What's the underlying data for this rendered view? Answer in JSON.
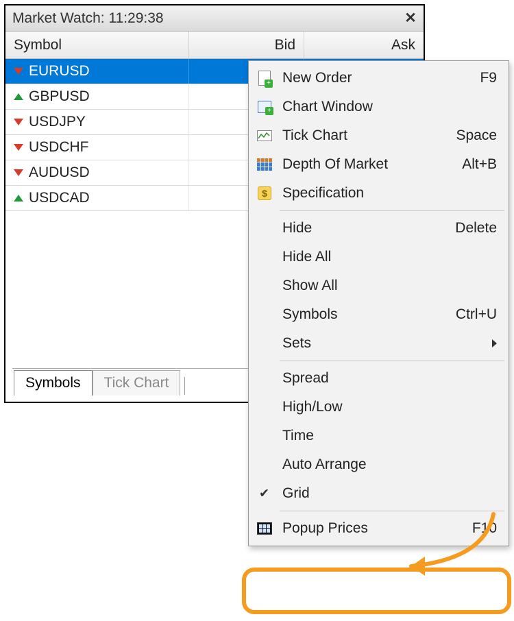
{
  "window": {
    "title": "Market Watch: 11:29:38"
  },
  "columns": {
    "symbol": "Symbol",
    "bid": "Bid",
    "ask": "Ask"
  },
  "rows": [
    {
      "symbol": "EURUSD",
      "direction": "down",
      "selected": true
    },
    {
      "symbol": "GBPUSD",
      "direction": "up",
      "selected": false
    },
    {
      "symbol": "USDJPY",
      "direction": "down",
      "selected": false
    },
    {
      "symbol": "USDCHF",
      "direction": "down",
      "selected": false
    },
    {
      "symbol": "AUDUSD",
      "direction": "down",
      "selected": false
    },
    {
      "symbol": "USDCAD",
      "direction": "up",
      "selected": false
    }
  ],
  "tabs": {
    "symbols": "Symbols",
    "tick_chart": "Tick Chart"
  },
  "menu": {
    "new_order": {
      "label": "New Order",
      "accel": "F9"
    },
    "chart_window": {
      "label": "Chart Window",
      "accel": ""
    },
    "tick_chart": {
      "label": "Tick Chart",
      "accel": "Space"
    },
    "dom": {
      "label": "Depth Of Market",
      "accel": "Alt+B"
    },
    "spec": {
      "label": "Specification",
      "accel": ""
    },
    "hide": {
      "label": "Hide",
      "accel": "Delete"
    },
    "hide_all": {
      "label": "Hide All",
      "accel": ""
    },
    "show_all": {
      "label": "Show All",
      "accel": ""
    },
    "symbols": {
      "label": "Symbols",
      "accel": "Ctrl+U"
    },
    "sets": {
      "label": "Sets",
      "accel": ""
    },
    "spread": {
      "label": "Spread",
      "accel": ""
    },
    "high_low": {
      "label": "High/Low",
      "accel": ""
    },
    "time": {
      "label": "Time",
      "accel": ""
    },
    "auto_arrange": {
      "label": "Auto Arrange",
      "accel": ""
    },
    "grid": {
      "label": "Grid",
      "accel": "",
      "checked": true
    },
    "popup_prices": {
      "label": "Popup Prices",
      "accel": "F10"
    }
  }
}
